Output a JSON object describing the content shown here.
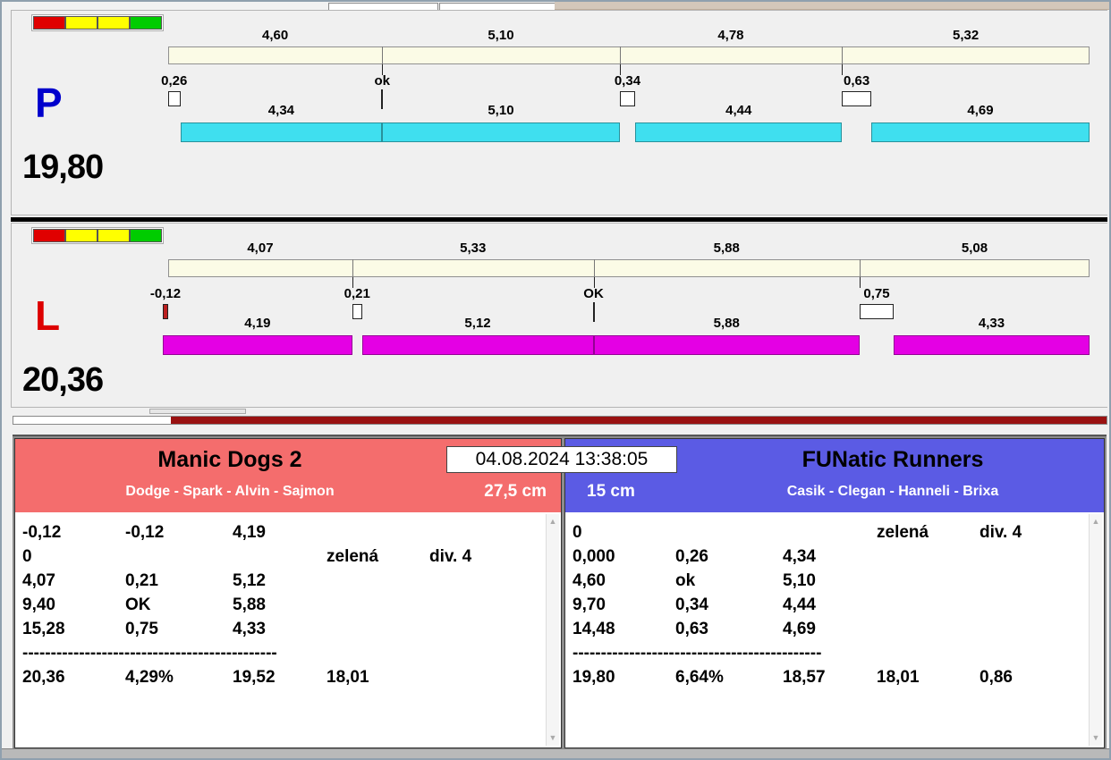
{
  "timestamp": "04.08.2024 13:38:05",
  "traffic_lights": [
    "#e00000",
    "#ffff00",
    "#ffff00",
    "#00cc00"
  ],
  "fault_color": "#bb2020",
  "lanes": [
    {
      "letter": "P",
      "letter_color": "#0000cc",
      "bar_color": "#3fdfef",
      "total_label": "19,80",
      "splits": [
        {
          "t": 4.6,
          "label": "4,60"
        },
        {
          "t": 5.1,
          "label": "5,10"
        },
        {
          "t": 4.78,
          "label": "4,78"
        },
        {
          "t": 5.32,
          "label": "5,32"
        }
      ],
      "crossings": [
        {
          "t": 0.26,
          "label": "0,26",
          "type": "box"
        },
        {
          "t": 0,
          "label": "ok",
          "type": "ok"
        },
        {
          "t": 0.34,
          "label": "0,34",
          "type": "box"
        },
        {
          "t": 0.63,
          "label": "0,63",
          "type": "box"
        }
      ],
      "dogs": [
        {
          "t": 4.34,
          "label": "4,34"
        },
        {
          "t": 5.1,
          "label": "5,10"
        },
        {
          "t": 4.44,
          "label": "4,44"
        },
        {
          "t": 4.69,
          "label": "4,69"
        }
      ]
    },
    {
      "letter": "L",
      "letter_color": "#dd0000",
      "bar_color": "#e400e4",
      "total_label": "20,36",
      "splits": [
        {
          "t": 4.07,
          "label": "4,07"
        },
        {
          "t": 5.33,
          "label": "5,33"
        },
        {
          "t": 5.88,
          "label": "5,88"
        },
        {
          "t": 5.08,
          "label": "5,08"
        }
      ],
      "crossings": [
        {
          "t": -0.12,
          "label": "-0,12",
          "type": "box"
        },
        {
          "t": 0.21,
          "label": "0,21",
          "type": "box"
        },
        {
          "t": 0,
          "label": "OK",
          "type": "ok"
        },
        {
          "t": 0.75,
          "label": "0,75",
          "type": "box"
        }
      ],
      "dogs": [
        {
          "t": 4.19,
          "label": "4,19"
        },
        {
          "t": 5.12,
          "label": "5,12"
        },
        {
          "t": 5.88,
          "label": "5,88"
        },
        {
          "t": 4.33,
          "label": "4,33"
        }
      ]
    }
  ],
  "progress": {
    "fill_color": "#991111",
    "fill_start_pct": 14.4
  },
  "panels": [
    {
      "team": "Manic Dogs 2",
      "members": "Dodge - Spark - Alvin - Sajmon",
      "height": "27,5 cm",
      "header_color": "#f46d6d",
      "rows": [
        [
          "-0,12",
          "-0,12",
          "4,19",
          "",
          ""
        ],
        [
          "0",
          "",
          "",
          "zelená",
          "div. 4"
        ],
        [
          "4,07",
          "0,21",
          "5,12",
          "",
          ""
        ],
        [
          "9,40",
          "OK",
          "5,88",
          "",
          ""
        ],
        [
          "15,28",
          "0,75",
          "4,33",
          "",
          ""
        ]
      ],
      "separator": "---------------------------------------------",
      "totals": [
        "20,36",
        "4,29%",
        "19,52",
        "18,01",
        ""
      ]
    },
    {
      "team": "FUNatic Runners",
      "members": "Casik - Clegan - Hanneli - Brixa",
      "height": "15 cm",
      "header_color": "#5b5be4",
      "rows": [
        [
          "0",
          "",
          "",
          "zelená",
          "div. 4"
        ],
        [
          "0,000",
          "0,26",
          "4,34",
          "",
          ""
        ],
        [
          "4,60",
          "ok",
          "5,10",
          "",
          ""
        ],
        [
          "9,70",
          "0,34",
          "4,44",
          "",
          ""
        ],
        [
          "14,48",
          "0,63",
          "4,69",
          "",
          ""
        ]
      ],
      "separator": "--------------------------------------------",
      "totals": [
        "19,80",
        "6,64%",
        "18,57",
        "18,01",
        "0,86"
      ]
    }
  ]
}
